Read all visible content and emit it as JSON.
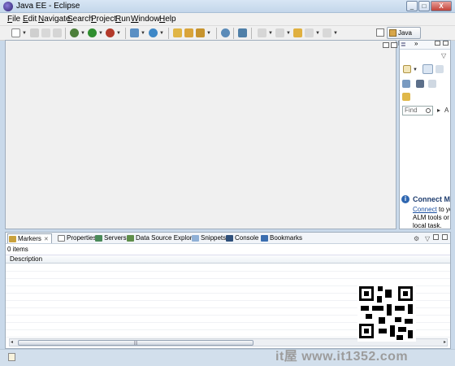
{
  "window": {
    "title": "Java EE - Eclipse",
    "minimize": "_",
    "maximize": "□",
    "close": "X"
  },
  "menubar": {
    "items": [
      "File",
      "Edit",
      "Navigate",
      "Search",
      "Project",
      "Run",
      "Window",
      "Help"
    ]
  },
  "toolbar": {
    "perspective_label": "Java EE",
    "accent_color": "#d7a64a"
  },
  "right_panel": {
    "find_placeholder": "Find",
    "more_arrow": "▸",
    "all_label": "A",
    "connect": {
      "heading": "Connect My",
      "link_text": "Connect",
      "body_text": " to yo ALM tools or c local task."
    }
  },
  "bottom_panel": {
    "tabs": [
      {
        "label": "Markers",
        "icon": "markers-icon",
        "active": true
      },
      {
        "label": "Properties",
        "icon": "properties-icon"
      },
      {
        "label": "Servers",
        "icon": "servers-icon"
      },
      {
        "label": "Data Source Explorer",
        "icon": "data-source-explorer-icon"
      },
      {
        "label": "Snippets",
        "icon": "snippets-icon"
      },
      {
        "label": "Console",
        "icon": "console-icon"
      },
      {
        "label": "Bookmarks",
        "icon": "bookmarks-icon"
      }
    ],
    "close_glyph": "✕",
    "item_count": "0 items",
    "column_header": "Description",
    "scroll_thumb_grip": "|||"
  },
  "watermark_text": "it屋 www.it1352.com"
}
